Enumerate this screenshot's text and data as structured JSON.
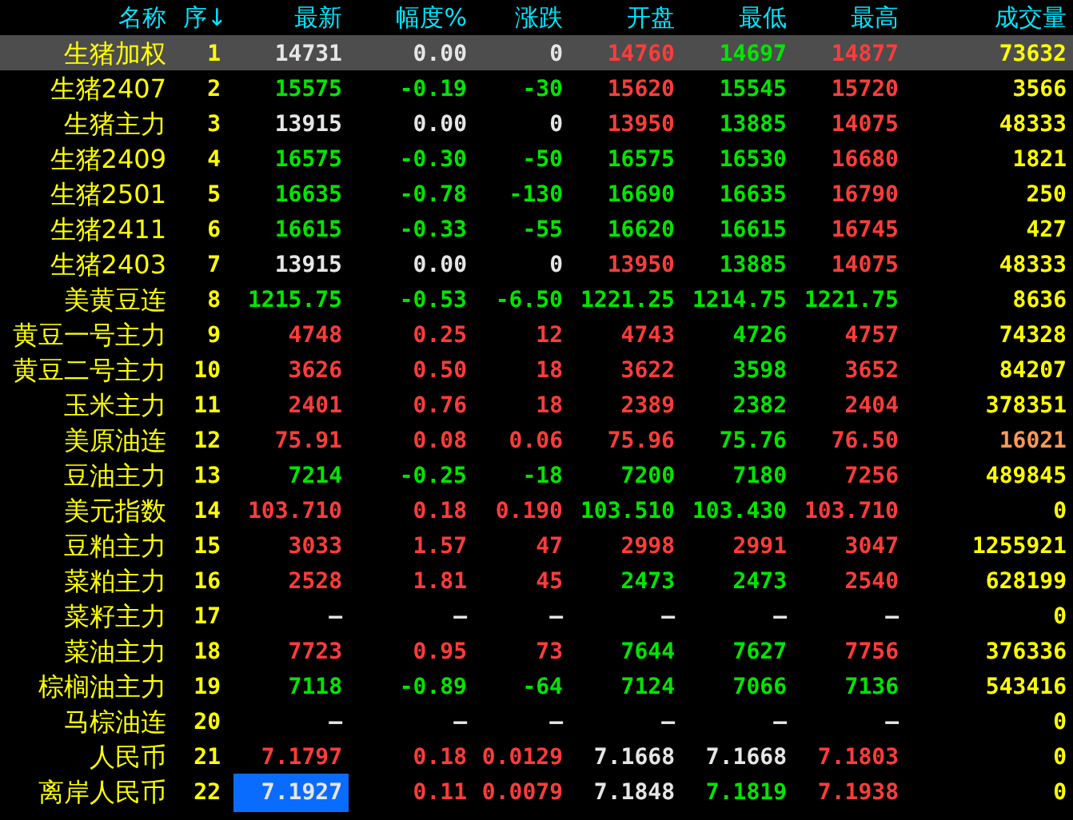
{
  "columns": [
    "名称",
    "序↓",
    "最新",
    "幅度%",
    "涨跌",
    "开盘",
    "最低",
    "最高",
    "成交量"
  ],
  "rows": [
    {
      "name": "生猪加权",
      "seq": "1",
      "selected": true,
      "cells": [
        {
          "text": "14731",
          "color": "#e6e6e6"
        },
        {
          "text": "0.00",
          "color": "#e6e6e6"
        },
        {
          "text": "0",
          "color": "#e6e6e6"
        },
        {
          "text": "14760",
          "color": "#ff3c3c"
        },
        {
          "text": "14697",
          "color": "#00e600"
        },
        {
          "text": "14877",
          "color": "#ff3c3c"
        },
        {
          "text": "73632",
          "color": "#ffff00"
        }
      ]
    },
    {
      "name": "生猪2407",
      "seq": "2",
      "selected": false,
      "cells": [
        {
          "text": "15575",
          "color": "#00e600"
        },
        {
          "text": "-0.19",
          "color": "#00e600"
        },
        {
          "text": "-30",
          "color": "#00e600"
        },
        {
          "text": "15620",
          "color": "#ff3c3c"
        },
        {
          "text": "15545",
          "color": "#00e600"
        },
        {
          "text": "15720",
          "color": "#ff3c3c"
        },
        {
          "text": "3566",
          "color": "#ffff00"
        }
      ]
    },
    {
      "name": "生猪主力",
      "seq": "3",
      "selected": false,
      "cells": [
        {
          "text": "13915",
          "color": "#e6e6e6"
        },
        {
          "text": "0.00",
          "color": "#e6e6e6"
        },
        {
          "text": "0",
          "color": "#e6e6e6"
        },
        {
          "text": "13950",
          "color": "#ff3c3c"
        },
        {
          "text": "13885",
          "color": "#00e600"
        },
        {
          "text": "14075",
          "color": "#ff3c3c"
        },
        {
          "text": "48333",
          "color": "#ffff00"
        }
      ]
    },
    {
      "name": "生猪2409",
      "seq": "4",
      "selected": false,
      "cells": [
        {
          "text": "16575",
          "color": "#00e600"
        },
        {
          "text": "-0.30",
          "color": "#00e600"
        },
        {
          "text": "-50",
          "color": "#00e600"
        },
        {
          "text": "16575",
          "color": "#00e600"
        },
        {
          "text": "16530",
          "color": "#00e600"
        },
        {
          "text": "16680",
          "color": "#ff3c3c"
        },
        {
          "text": "1821",
          "color": "#ffff00"
        }
      ]
    },
    {
      "name": "生猪2501",
      "seq": "5",
      "selected": false,
      "cells": [
        {
          "text": "16635",
          "color": "#00e600"
        },
        {
          "text": "-0.78",
          "color": "#00e600"
        },
        {
          "text": "-130",
          "color": "#00e600"
        },
        {
          "text": "16690",
          "color": "#00e600"
        },
        {
          "text": "16635",
          "color": "#00e600"
        },
        {
          "text": "16790",
          "color": "#ff3c3c"
        },
        {
          "text": "250",
          "color": "#ffff00"
        }
      ]
    },
    {
      "name": "生猪2411",
      "seq": "6",
      "selected": false,
      "cells": [
        {
          "text": "16615",
          "color": "#00e600"
        },
        {
          "text": "-0.33",
          "color": "#00e600"
        },
        {
          "text": "-55",
          "color": "#00e600"
        },
        {
          "text": "16620",
          "color": "#00e600"
        },
        {
          "text": "16615",
          "color": "#00e600"
        },
        {
          "text": "16745",
          "color": "#ff3c3c"
        },
        {
          "text": "427",
          "color": "#ffff00"
        }
      ]
    },
    {
      "name": "生猪2403",
      "seq": "7",
      "selected": false,
      "cells": [
        {
          "text": "13915",
          "color": "#e6e6e6"
        },
        {
          "text": "0.00",
          "color": "#e6e6e6"
        },
        {
          "text": "0",
          "color": "#e6e6e6"
        },
        {
          "text": "13950",
          "color": "#ff3c3c"
        },
        {
          "text": "13885",
          "color": "#00e600"
        },
        {
          "text": "14075",
          "color": "#ff3c3c"
        },
        {
          "text": "48333",
          "color": "#ffff00"
        }
      ]
    },
    {
      "name": "美黄豆连",
      "seq": "8",
      "selected": false,
      "cells": [
        {
          "text": "1215.75",
          "color": "#00e600"
        },
        {
          "text": "-0.53",
          "color": "#00e600"
        },
        {
          "text": "-6.50",
          "color": "#00e600"
        },
        {
          "text": "1221.25",
          "color": "#00e600"
        },
        {
          "text": "1214.75",
          "color": "#00e600"
        },
        {
          "text": "1221.75",
          "color": "#00e600"
        },
        {
          "text": "8636",
          "color": "#ffff00"
        }
      ]
    },
    {
      "name": "黄豆一号主力",
      "seq": "9",
      "selected": false,
      "cells": [
        {
          "text": "4748",
          "color": "#ff3c3c"
        },
        {
          "text": "0.25",
          "color": "#ff3c3c"
        },
        {
          "text": "12",
          "color": "#ff3c3c"
        },
        {
          "text": "4743",
          "color": "#ff3c3c"
        },
        {
          "text": "4726",
          "color": "#00e600"
        },
        {
          "text": "4757",
          "color": "#ff3c3c"
        },
        {
          "text": "74328",
          "color": "#ffff00"
        }
      ]
    },
    {
      "name": "黄豆二号主力",
      "seq": "10",
      "selected": false,
      "cells": [
        {
          "text": "3626",
          "color": "#ff3c3c"
        },
        {
          "text": "0.50",
          "color": "#ff3c3c"
        },
        {
          "text": "18",
          "color": "#ff3c3c"
        },
        {
          "text": "3622",
          "color": "#ff3c3c"
        },
        {
          "text": "3598",
          "color": "#00e600"
        },
        {
          "text": "3652",
          "color": "#ff3c3c"
        },
        {
          "text": "84207",
          "color": "#ffff00"
        }
      ]
    },
    {
      "name": "玉米主力",
      "seq": "11",
      "selected": false,
      "cells": [
        {
          "text": "2401",
          "color": "#ff3c3c"
        },
        {
          "text": "0.76",
          "color": "#ff3c3c"
        },
        {
          "text": "18",
          "color": "#ff3c3c"
        },
        {
          "text": "2389",
          "color": "#ff3c3c"
        },
        {
          "text": "2382",
          "color": "#00e600"
        },
        {
          "text": "2404",
          "color": "#ff3c3c"
        },
        {
          "text": "378351",
          "color": "#ffff00"
        }
      ]
    },
    {
      "name": "美原油连",
      "seq": "12",
      "selected": false,
      "cells": [
        {
          "text": "75.91",
          "color": "#ff3c3c"
        },
        {
          "text": "0.08",
          "color": "#ff3c3c"
        },
        {
          "text": "0.06",
          "color": "#ff3c3c"
        },
        {
          "text": "75.96",
          "color": "#ff3c3c"
        },
        {
          "text": "75.76",
          "color": "#00e600"
        },
        {
          "text": "76.50",
          "color": "#ff3c3c"
        },
        {
          "text": "16021",
          "color": "#ff9955"
        }
      ]
    },
    {
      "name": "豆油主力",
      "seq": "13",
      "selected": false,
      "cells": [
        {
          "text": "7214",
          "color": "#00e600"
        },
        {
          "text": "-0.25",
          "color": "#00e600"
        },
        {
          "text": "-18",
          "color": "#00e600"
        },
        {
          "text": "7200",
          "color": "#00e600"
        },
        {
          "text": "7180",
          "color": "#00e600"
        },
        {
          "text": "7256",
          "color": "#ff3c3c"
        },
        {
          "text": "489845",
          "color": "#ffff00"
        }
      ]
    },
    {
      "name": "美元指数",
      "seq": "14",
      "selected": false,
      "cells": [
        {
          "text": "103.710",
          "color": "#ff3c3c"
        },
        {
          "text": "0.18",
          "color": "#ff3c3c"
        },
        {
          "text": "0.190",
          "color": "#ff3c3c"
        },
        {
          "text": "103.510",
          "color": "#00e600"
        },
        {
          "text": "103.430",
          "color": "#00e600"
        },
        {
          "text": "103.710",
          "color": "#ff3c3c"
        },
        {
          "text": "0",
          "color": "#ffff00"
        }
      ]
    },
    {
      "name": "豆粕主力",
      "seq": "15",
      "selected": false,
      "cells": [
        {
          "text": "3033",
          "color": "#ff3c3c"
        },
        {
          "text": "1.57",
          "color": "#ff3c3c"
        },
        {
          "text": "47",
          "color": "#ff3c3c"
        },
        {
          "text": "2998",
          "color": "#ff3c3c"
        },
        {
          "text": "2991",
          "color": "#ff3c3c"
        },
        {
          "text": "3047",
          "color": "#ff3c3c"
        },
        {
          "text": "1255921",
          "color": "#ffff00"
        }
      ]
    },
    {
      "name": "菜粕主力",
      "seq": "16",
      "selected": false,
      "cells": [
        {
          "text": "2528",
          "color": "#ff3c3c"
        },
        {
          "text": "1.81",
          "color": "#ff3c3c"
        },
        {
          "text": "45",
          "color": "#ff3c3c"
        },
        {
          "text": "2473",
          "color": "#00e600"
        },
        {
          "text": "2473",
          "color": "#00e600"
        },
        {
          "text": "2540",
          "color": "#ff3c3c"
        },
        {
          "text": "628199",
          "color": "#ffff00"
        }
      ]
    },
    {
      "name": "菜籽主力",
      "seq": "17",
      "selected": false,
      "cells": [
        {
          "text": "—",
          "color": "#e6e6e6"
        },
        {
          "text": "—",
          "color": "#e6e6e6"
        },
        {
          "text": "—",
          "color": "#e6e6e6"
        },
        {
          "text": "—",
          "color": "#e6e6e6"
        },
        {
          "text": "—",
          "color": "#e6e6e6"
        },
        {
          "text": "—",
          "color": "#e6e6e6"
        },
        {
          "text": "0",
          "color": "#ffff00"
        }
      ]
    },
    {
      "name": "菜油主力",
      "seq": "18",
      "selected": false,
      "cells": [
        {
          "text": "7723",
          "color": "#ff3c3c"
        },
        {
          "text": "0.95",
          "color": "#ff3c3c"
        },
        {
          "text": "73",
          "color": "#ff3c3c"
        },
        {
          "text": "7644",
          "color": "#00e600"
        },
        {
          "text": "7627",
          "color": "#00e600"
        },
        {
          "text": "7756",
          "color": "#ff3c3c"
        },
        {
          "text": "376336",
          "color": "#ffff00"
        }
      ]
    },
    {
      "name": "棕榈油主力",
      "seq": "19",
      "selected": false,
      "cells": [
        {
          "text": "7118",
          "color": "#00e600"
        },
        {
          "text": "-0.89",
          "color": "#00e600"
        },
        {
          "text": "-64",
          "color": "#00e600"
        },
        {
          "text": "7124",
          "color": "#00e600"
        },
        {
          "text": "7066",
          "color": "#00e600"
        },
        {
          "text": "7136",
          "color": "#00e600"
        },
        {
          "text": "543416",
          "color": "#ffff00"
        }
      ]
    },
    {
      "name": "马棕油连",
      "seq": "20",
      "selected": false,
      "cells": [
        {
          "text": "—",
          "color": "#e6e6e6"
        },
        {
          "text": "—",
          "color": "#e6e6e6"
        },
        {
          "text": "—",
          "color": "#e6e6e6"
        },
        {
          "text": "—",
          "color": "#e6e6e6"
        },
        {
          "text": "—",
          "color": "#e6e6e6"
        },
        {
          "text": "—",
          "color": "#e6e6e6"
        },
        {
          "text": "0",
          "color": "#ffff00"
        }
      ]
    },
    {
      "name": "人民币",
      "seq": "21",
      "selected": false,
      "cells": [
        {
          "text": "7.1797",
          "color": "#ff3c3c"
        },
        {
          "text": "0.18",
          "color": "#ff3c3c"
        },
        {
          "text": "0.0129",
          "color": "#ff3c3c"
        },
        {
          "text": "7.1668",
          "color": "#e6e6e6"
        },
        {
          "text": "7.1668",
          "color": "#e6e6e6"
        },
        {
          "text": "7.1803",
          "color": "#ff3c3c"
        },
        {
          "text": "0",
          "color": "#ffff00"
        }
      ]
    },
    {
      "name": "离岸人民币",
      "seq": "22",
      "selected": false,
      "cells": [
        {
          "text": "7.1927",
          "color": "#e6e6e6",
          "selected": true
        },
        {
          "text": "0.11",
          "color": "#ff3c3c"
        },
        {
          "text": "0.0079",
          "color": "#ff3c3c"
        },
        {
          "text": "7.1848",
          "color": "#e6e6e6"
        },
        {
          "text": "7.1819",
          "color": "#00e600"
        },
        {
          "text": "7.1938",
          "color": "#ff3c3c"
        },
        {
          "text": "0",
          "color": "#ffff00"
        }
      ]
    }
  ]
}
